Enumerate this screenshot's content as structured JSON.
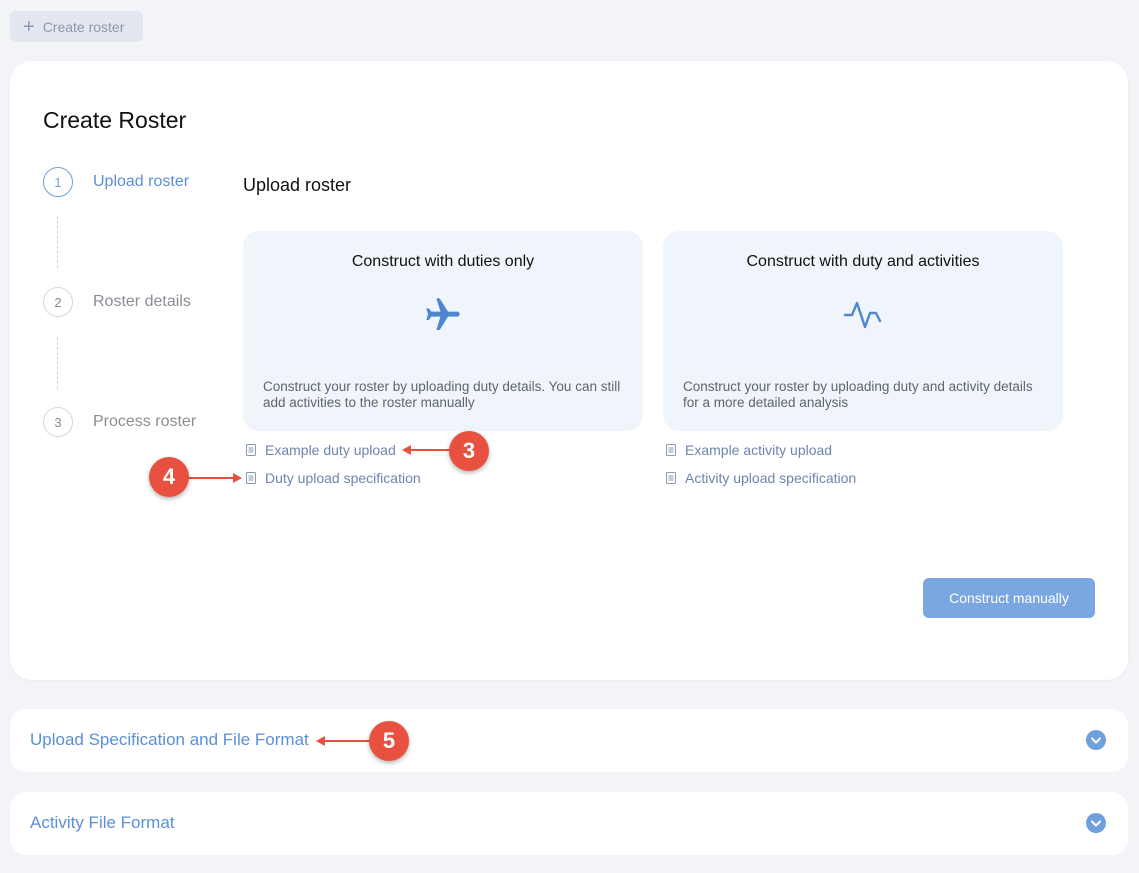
{
  "toolbar": {
    "create_roster_label": "Create roster"
  },
  "card": {
    "title": "Create Roster",
    "steps": [
      {
        "number": "1",
        "label": "Upload roster",
        "active": true
      },
      {
        "number": "2",
        "label": "Roster details",
        "active": false
      },
      {
        "number": "3",
        "label": "Process roster",
        "active": false
      }
    ],
    "section_title": "Upload roster",
    "options": [
      {
        "title": "Construct with duties only",
        "icon": "airplane-icon",
        "description": "Construct your roster by uploading duty details. You can still add activities to the roster manually"
      },
      {
        "title": "Construct with duty and activities",
        "icon": "activity-pulse-icon",
        "description": "Construct your roster by uploading duty and activity details for a more detailed analysis"
      }
    ],
    "links": [
      {
        "label": "Example duty upload"
      },
      {
        "label": "Duty upload specification"
      },
      {
        "label": "Example activity upload"
      },
      {
        "label": "Activity upload specification"
      }
    ],
    "construct_manually_label": "Construct manually"
  },
  "accordions": [
    {
      "title": "Upload Specification and File Format"
    },
    {
      "title": "Activity File Format"
    }
  ],
  "annotations": {
    "badge_3": "3",
    "badge_4": "4",
    "badge_5": "5"
  },
  "colors": {
    "accent": "#5b8fd6",
    "button": "#7aa6e2",
    "option_bg": "#f0f5fc",
    "badge": "#e8503f"
  }
}
